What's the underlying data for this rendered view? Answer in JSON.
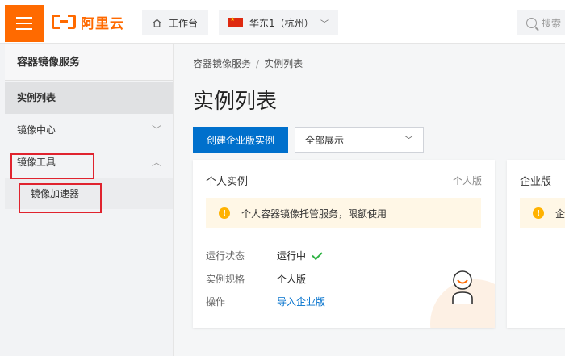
{
  "header": {
    "brand": "阿里云",
    "workbench": "工作台",
    "region": "华东1（杭州）",
    "search_placeholder": "搜索"
  },
  "sidebar": {
    "title": "容器镜像服务",
    "items": [
      {
        "label": "实例列表"
      },
      {
        "label": "镜像中心"
      },
      {
        "label": "镜像工具"
      },
      {
        "label": "镜像加速器"
      }
    ]
  },
  "main": {
    "breadcrumb": [
      "容器镜像服务",
      "实例列表"
    ],
    "breadcrumb_sep": "/",
    "title": "实例列表",
    "create_button": "创建企业版实例",
    "filter_select": "全部展示",
    "cards": [
      {
        "title": "个人实例",
        "tag": "个人版",
        "notice": "个人容器镜像托管服务，限额使用",
        "rows": [
          {
            "key": "运行状态",
            "value": "运行中"
          },
          {
            "key": "实例规格",
            "value": "个人版"
          },
          {
            "key": "操作",
            "value": "导入企业版"
          }
        ]
      },
      {
        "title": "企业版",
        "notice": "企"
      }
    ]
  },
  "colors": {
    "brand": "#ff6a00",
    "primary": "#0070cc",
    "highlight": "#e0232e",
    "warning": "#ffb200",
    "success": "#2fb344"
  }
}
